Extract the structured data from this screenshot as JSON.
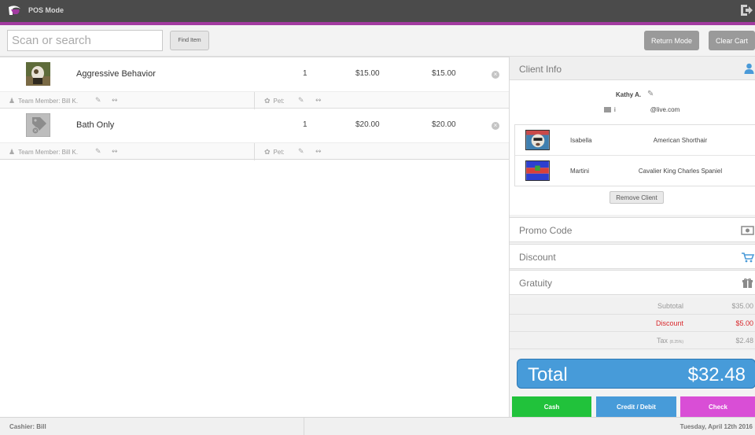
{
  "app": {
    "title": "POS Mode"
  },
  "toolbar": {
    "search_placeholder": "Scan or search",
    "find_label": "Find Item",
    "return_label": "Return Mode",
    "clear_label": "Clear Cart"
  },
  "cart": {
    "items": [
      {
        "name": "Aggressive Behavior",
        "qty": "1",
        "price": "$15.00",
        "total": "$15.00",
        "remove_glyph": "×",
        "member_label": "Team Member: Bill K.",
        "pet_label": "Pet:",
        "thumb_icon": "dog-photo"
      },
      {
        "name": "Bath Only",
        "qty": "1",
        "price": "$20.00",
        "total": "$20.00",
        "remove_glyph": "×",
        "member_label": "Team Member: Bill K.",
        "pet_label": "Pet:",
        "thumb_icon": "tag-placeholder-icon"
      }
    ]
  },
  "client": {
    "section_title": "Client Info",
    "name": "Kathy A.",
    "email_prefix": "i",
    "email_domain": "@live.com",
    "pets": [
      {
        "name": "Isabella",
        "breed": "American Shorthair"
      },
      {
        "name": "Martini",
        "breed": "Cavalier King Charles Spaniel"
      }
    ],
    "remove_label": "Remove Client"
  },
  "sections": {
    "promo": "Promo Code",
    "discount": "Discount",
    "gratuity": "Gratuity"
  },
  "summary": {
    "subtotal_label": "Subtotal",
    "subtotal": "$35.00",
    "discount_label": "Discount",
    "discount": "$5.00",
    "tax_label": "Tax",
    "tax_rate": "(8.25%)",
    "tax": "$2.48"
  },
  "total": {
    "label": "Total",
    "value": "$32.48"
  },
  "payment": {
    "cash": "Cash",
    "card": "Credit / Debit",
    "check": "Check"
  },
  "status": {
    "cashier": "Cashier: Bill",
    "date": "Tuesday, April 12th 2016"
  },
  "colors": {
    "accent": "#a23aa0",
    "total_blue": "#479bd9",
    "cash_green": "#21c23b",
    "check_pink": "#d94ed6",
    "discount_red": "#d9282c"
  }
}
